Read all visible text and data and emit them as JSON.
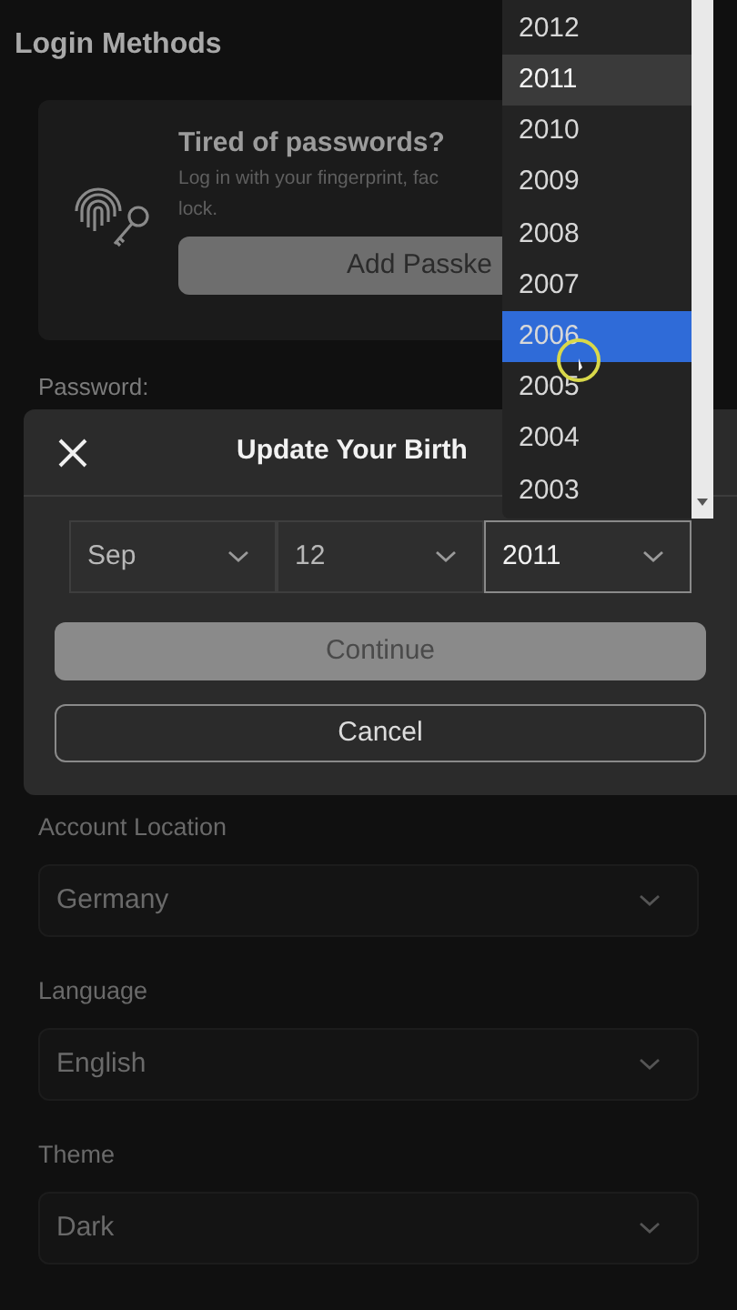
{
  "section_title": "Login Methods",
  "passkey_card": {
    "title": "Tired of passwords?",
    "description_lines": [
      "Log in with your fingerprint, fac",
      "lock."
    ],
    "button": "Add Passke"
  },
  "password_label": "Password:",
  "settings": [
    {
      "label": "Account Location",
      "value": "Germany"
    },
    {
      "label": "Language",
      "value": "English"
    },
    {
      "label": "Theme",
      "value": "Dark"
    }
  ],
  "dialog": {
    "title": "Update Your Birth",
    "selects": [
      {
        "value": "Sep",
        "focused": false
      },
      {
        "value": "12",
        "focused": false
      },
      {
        "value": "2011",
        "focused": true
      }
    ],
    "buttons": [
      {
        "label": "Continue",
        "kind": "primary",
        "disabled": true
      },
      {
        "label": "Cancel",
        "kind": "outline",
        "disabled": false
      }
    ]
  },
  "year_dropdown": [
    {
      "label": "2012",
      "selected": false,
      "highlighted": false
    },
    {
      "label": "2011",
      "selected": true,
      "highlighted": false
    },
    {
      "label": "2010",
      "selected": false,
      "highlighted": false
    },
    {
      "label": "2009",
      "selected": false,
      "highlighted": false
    },
    {
      "label": "2008",
      "selected": false,
      "highlighted": false
    },
    {
      "label": "2007",
      "selected": false,
      "highlighted": false
    },
    {
      "label": "2006",
      "selected": false,
      "highlighted": true
    },
    {
      "label": "2005",
      "selected": false,
      "highlighted": false
    },
    {
      "label": "2004",
      "selected": false,
      "highlighted": false
    },
    {
      "label": "2003",
      "selected": false,
      "highlighted": false
    }
  ]
}
